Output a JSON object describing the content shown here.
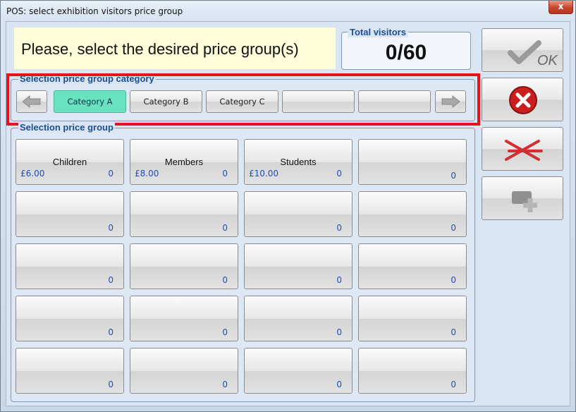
{
  "window": {
    "title": "POS: select exhibition visitors price group",
    "close_label": "x"
  },
  "prompt": {
    "text": "Please, select the desired price group(s)"
  },
  "visitors": {
    "label": "Total visitors",
    "value": "0/60"
  },
  "categories": {
    "label": "Selection price group category",
    "items": [
      {
        "label": "Category A",
        "selected": true
      },
      {
        "label": "Category B",
        "selected": false
      },
      {
        "label": "Category C",
        "selected": false
      },
      {
        "label": "",
        "selected": false
      },
      {
        "label": "",
        "selected": false
      }
    ]
  },
  "price_groups": {
    "label": "Selection price group",
    "tiles": [
      {
        "name": "Children",
        "price": "£6.00",
        "count": "0"
      },
      {
        "name": "Members",
        "price": "£8.00",
        "count": "0"
      },
      {
        "name": "Students",
        "price": "£10.00",
        "count": "0"
      },
      {
        "name": "",
        "price": "",
        "count": "0"
      },
      {
        "name": "",
        "price": "",
        "count": "0"
      },
      {
        "name": "",
        "price": "",
        "count": "0"
      },
      {
        "name": "",
        "price": "",
        "count": "0"
      },
      {
        "name": "",
        "price": "",
        "count": "0"
      },
      {
        "name": "",
        "price": "",
        "count": "0"
      },
      {
        "name": "",
        "price": "",
        "count": "0"
      },
      {
        "name": "",
        "price": "",
        "count": "0"
      },
      {
        "name": "",
        "price": "",
        "count": "0"
      },
      {
        "name": "",
        "price": "",
        "count": "0"
      },
      {
        "name": "",
        "price": "",
        "count": "0"
      },
      {
        "name": "",
        "price": "",
        "count": "0"
      },
      {
        "name": "",
        "price": "",
        "count": "0"
      },
      {
        "name": "",
        "price": "",
        "count": "0"
      },
      {
        "name": "",
        "price": "",
        "count": "0"
      },
      {
        "name": "",
        "price": "",
        "count": "0"
      },
      {
        "name": "",
        "price": "",
        "count": "0"
      }
    ]
  },
  "actions": {
    "ok_label": "OK",
    "icons": [
      "checkmark-icon",
      "cancel-icon",
      "clear-selection-icon",
      "add-icon"
    ]
  },
  "colors": {
    "highlight": "#e5131c",
    "selected_category": "#69e2bf",
    "price_text": "#1f4fc0",
    "group_label": "#1d4e92"
  }
}
